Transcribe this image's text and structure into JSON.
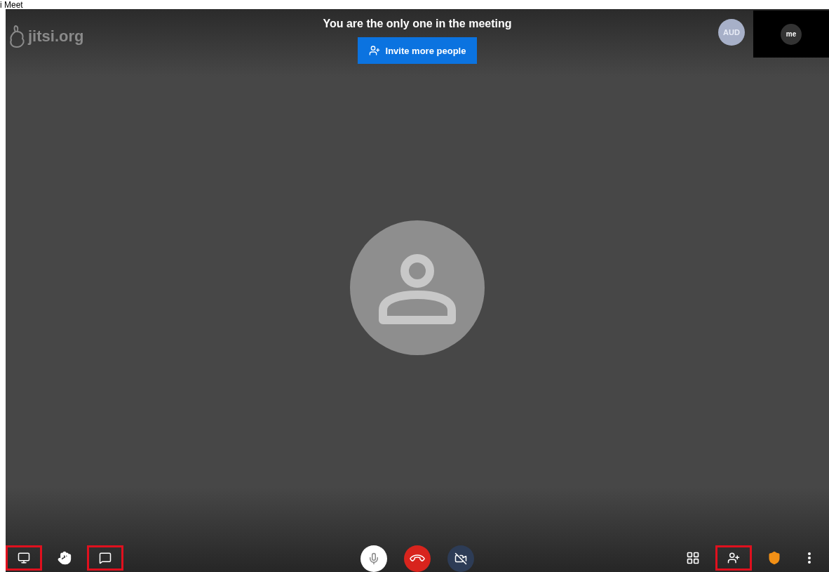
{
  "header": {
    "text": "i Meet"
  },
  "logo": {
    "text": "jitsi.org"
  },
  "notice": {
    "title": "You are the only one in the meeting",
    "invite_button": "Invite more people"
  },
  "remote_avatar": {
    "initials": "AUD"
  },
  "local_thumbnail": {
    "initials": "me"
  },
  "toolbar": {
    "left": [
      {
        "kind": "screen-share",
        "highlighted": true
      },
      {
        "kind": "raise-hand",
        "highlighted": false
      },
      {
        "kind": "chat",
        "highlighted": true
      }
    ],
    "center": [
      {
        "kind": "mic"
      },
      {
        "kind": "hangup"
      },
      {
        "kind": "camera"
      }
    ],
    "right": [
      {
        "kind": "tile-view",
        "highlighted": false
      },
      {
        "kind": "participants",
        "highlighted": true
      },
      {
        "kind": "security",
        "highlighted": false
      },
      {
        "kind": "more",
        "highlighted": false
      }
    ]
  }
}
